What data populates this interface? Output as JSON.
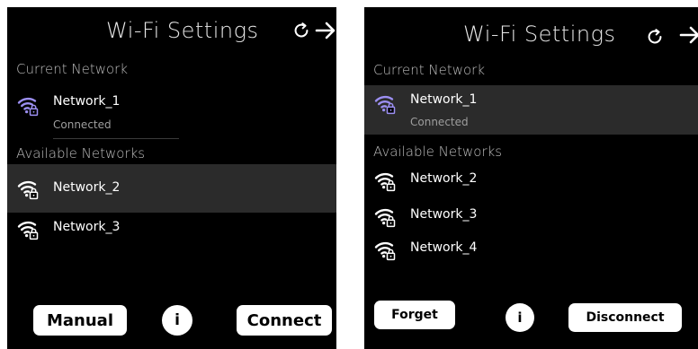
{
  "colors": {
    "background": "#000000",
    "selected_row": "#2b2b2b",
    "wifi_connected": "#9c8ff2",
    "wifi_available": "#ffffff",
    "button": "#ffffff"
  },
  "left": {
    "title": "Wi-Fi Settings",
    "refresh_icon": "refresh-icon",
    "next_icon": "arrow-right-icon",
    "current_label": "Current Network",
    "current": {
      "name": "Network_1",
      "status": "Connected",
      "icon": "wifi-lock-icon"
    },
    "available_label": "Available Networks",
    "networks": [
      {
        "name": "Network_2",
        "selected": true
      },
      {
        "name": "Network_3",
        "selected": false
      }
    ],
    "buttons": {
      "manual": "Manual",
      "info": "i",
      "connect": "Connect"
    }
  },
  "right": {
    "title": "Wi-Fi Settings",
    "refresh_icon": "refresh-icon",
    "next_icon": "arrow-right-icon",
    "current_label": "Current Network",
    "current": {
      "name": "Network_1",
      "status": "Connected",
      "icon": "wifi-lock-icon",
      "selected": true
    },
    "available_label": "Available Networks",
    "networks": [
      {
        "name": "Network_2"
      },
      {
        "name": "Network_3"
      },
      {
        "name": "Network_4"
      }
    ],
    "buttons": {
      "forget": "Forget",
      "info": "i",
      "disconnect": "Disconnect"
    }
  }
}
